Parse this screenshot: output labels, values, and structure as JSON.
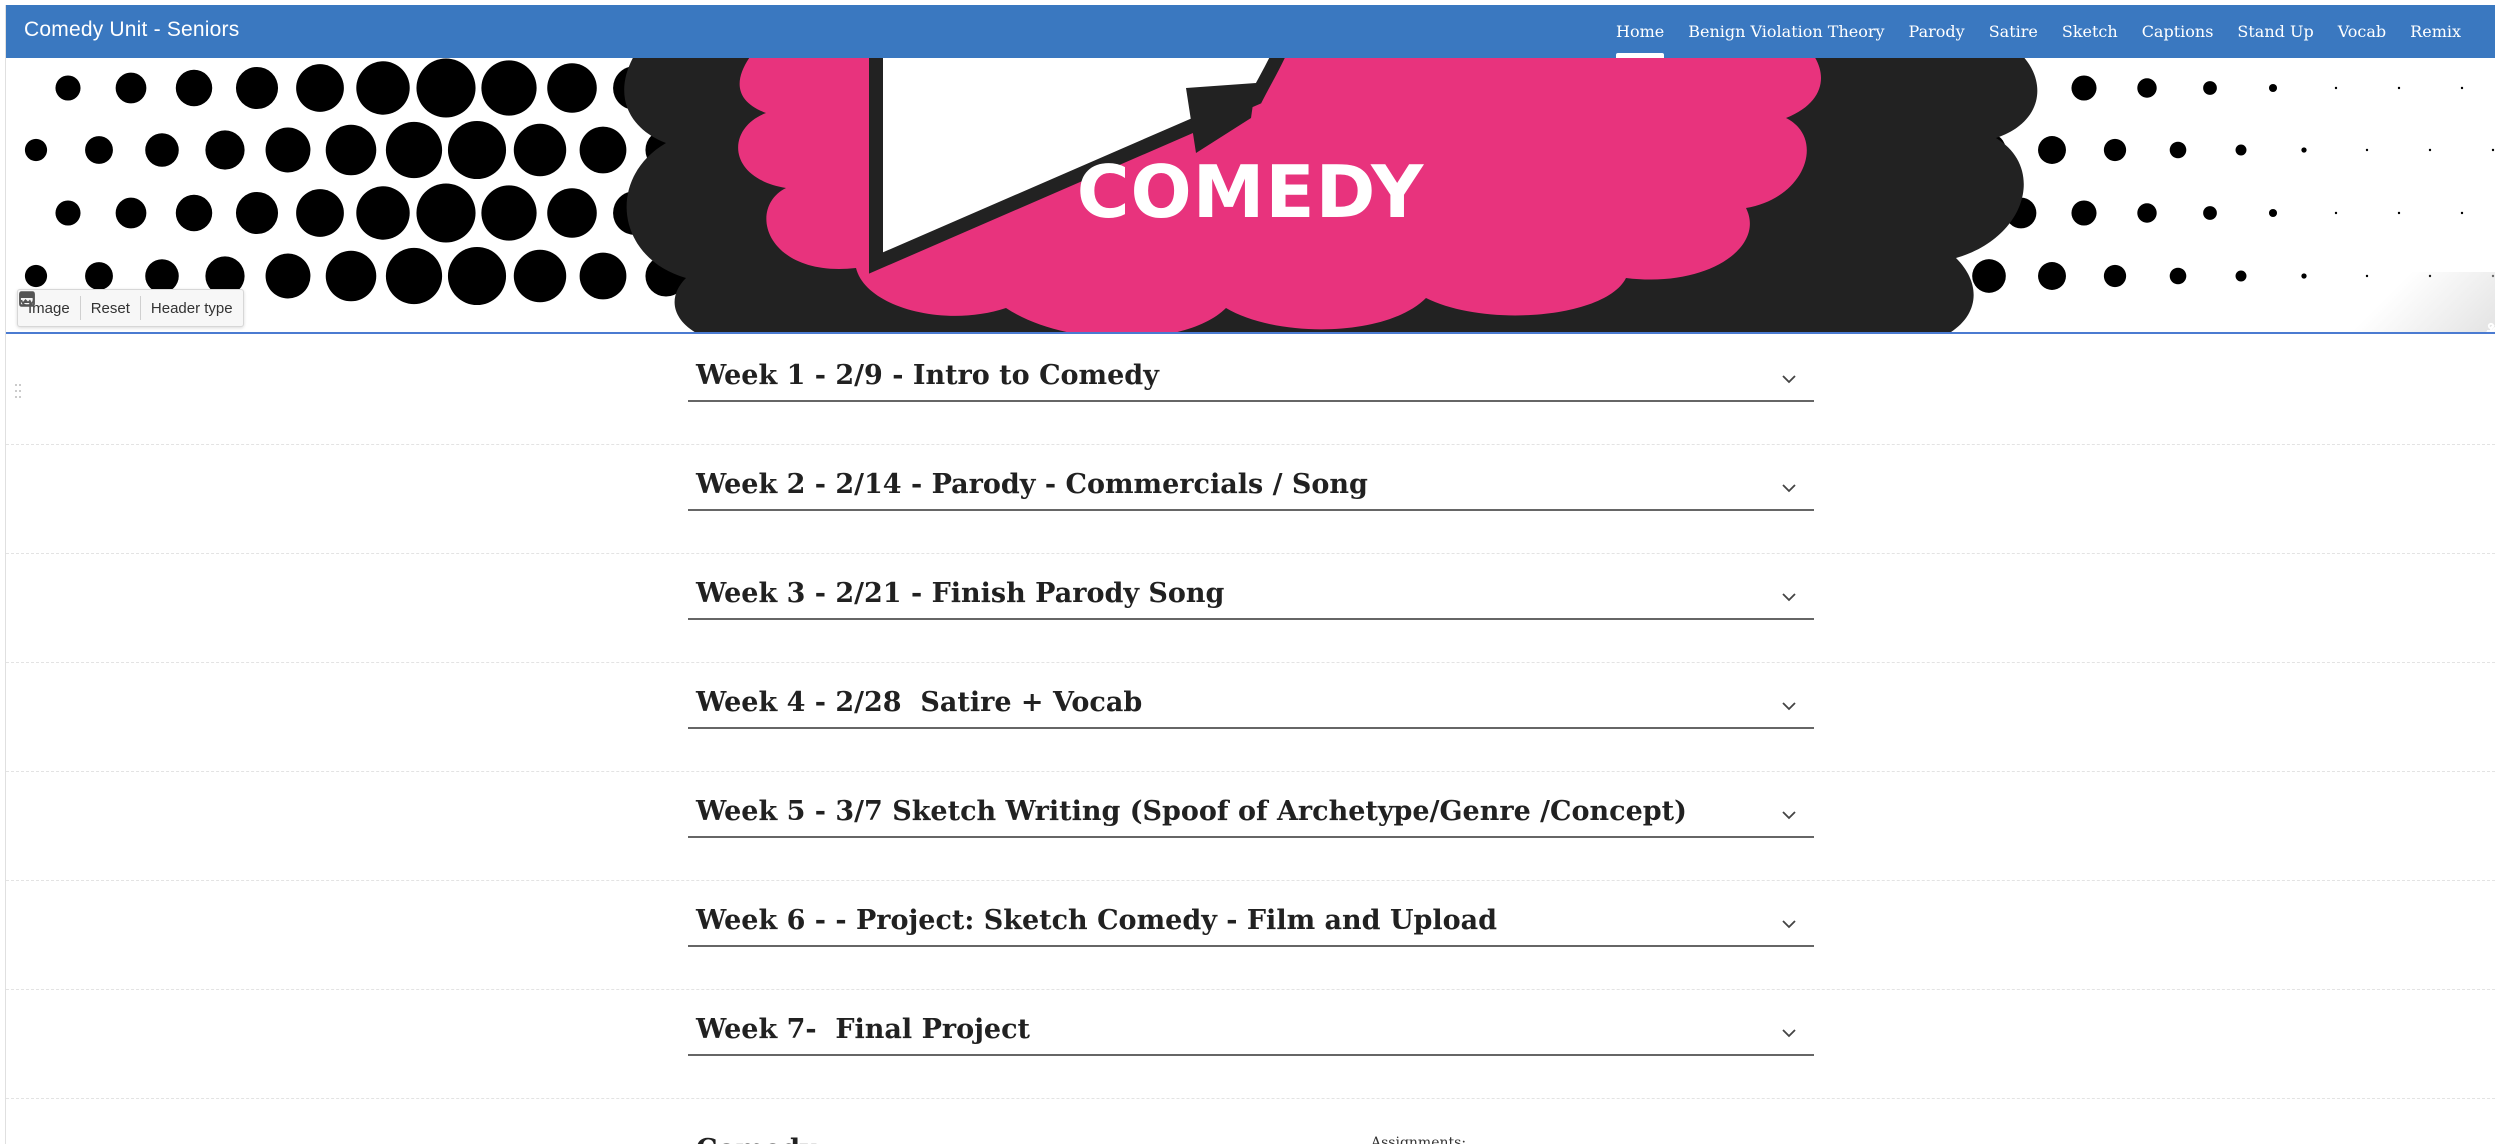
{
  "site": {
    "title": "Comedy Unit - Seniors"
  },
  "nav": {
    "items": [
      {
        "label": "Home",
        "active": true
      },
      {
        "label": "Benign Violation Theory"
      },
      {
        "label": "Parody"
      },
      {
        "label": "Satire"
      },
      {
        "label": "Sketch"
      },
      {
        "label": "Captions"
      },
      {
        "label": "Stand Up"
      },
      {
        "label": "Vocab"
      },
      {
        "label": "Remix"
      }
    ]
  },
  "banner": {
    "title": "COMEDY",
    "toolbar": {
      "image_label": "Image",
      "reset_label": "Reset",
      "header_type_label": "Header type"
    },
    "colors": {
      "pink": "#e8337d",
      "black": "#222222",
      "dots": "#000000"
    }
  },
  "sections": [
    {
      "title": "Week 1 - 2/9 - Intro to Comedy"
    },
    {
      "title": "Week 2 - 2/14 - Parody - Commercials / Song"
    },
    {
      "title": "Week 3 - 2/21 - Finish Parody Song"
    },
    {
      "title": "Week 4 - 2/28  Satire + Vocab"
    },
    {
      "title": "Week 5 - 3/7 Sketch Writing (Spoof of Archetype/Genre /Concept)"
    },
    {
      "title": "Week 6 - - Project: Sketch Comedy - Film and Upload"
    },
    {
      "title": "Week 7-  Final Project"
    }
  ],
  "bottom": {
    "title": "Comedy",
    "assignments_label": "Assignments:"
  },
  "colors": {
    "topbar": "#3a78c0",
    "banner_border": "#4b7bd1"
  }
}
